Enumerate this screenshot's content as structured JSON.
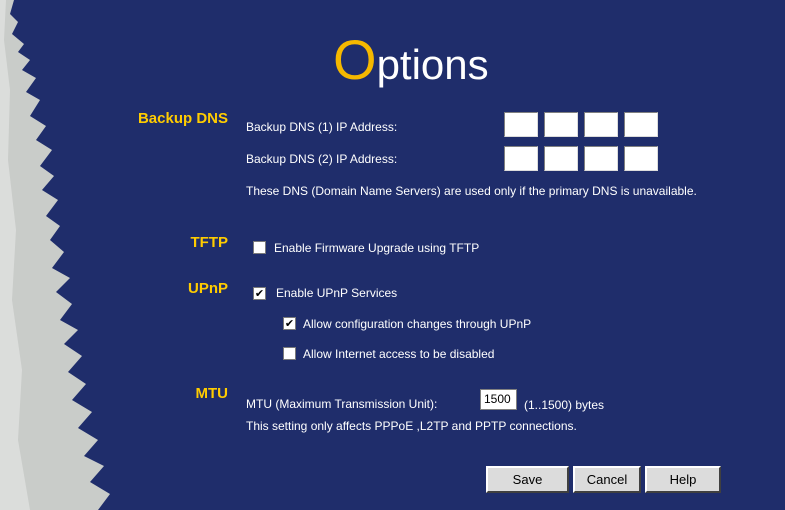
{
  "page": {
    "title_first_letter": "O",
    "title_rest": "ptions"
  },
  "backup_dns": {
    "section_label": "Backup DNS",
    "dns1_label": "Backup DNS (1) IP Address:",
    "dns2_label": "Backup DNS (2) IP Address:",
    "dns1_octets": [
      "",
      "",
      "",
      ""
    ],
    "dns2_octets": [
      "",
      "",
      "",
      ""
    ],
    "note": "These DNS (Domain Name Servers) are used only if the primary DNS is unavailable."
  },
  "tftp": {
    "section_label": "TFTP",
    "enable_label": "Enable Firmware Upgrade using TFTP",
    "enable_checked": false
  },
  "upnp": {
    "section_label": "UPnP",
    "enable_label": "Enable UPnP Services",
    "enable_checked": true,
    "allow_config_label": "Allow configuration changes through UPnP",
    "allow_config_checked": true,
    "allow_disable_label": "Allow Internet access to be disabled",
    "allow_disable_checked": false
  },
  "mtu": {
    "section_label": "MTU",
    "field_label": "MTU (Maximum Transmission Unit):",
    "value": "1500",
    "range_label": "(1..1500) bytes",
    "note": "This setting only affects PPPoE ,L2TP and PPTP connections."
  },
  "buttons": {
    "save": "Save",
    "cancel": "Cancel",
    "help": "Help"
  },
  "colors": {
    "background": "#1f2d6b",
    "section_label": "#ffcc00",
    "title_accent": "#f5b800",
    "edge": "#c9ccc9"
  }
}
